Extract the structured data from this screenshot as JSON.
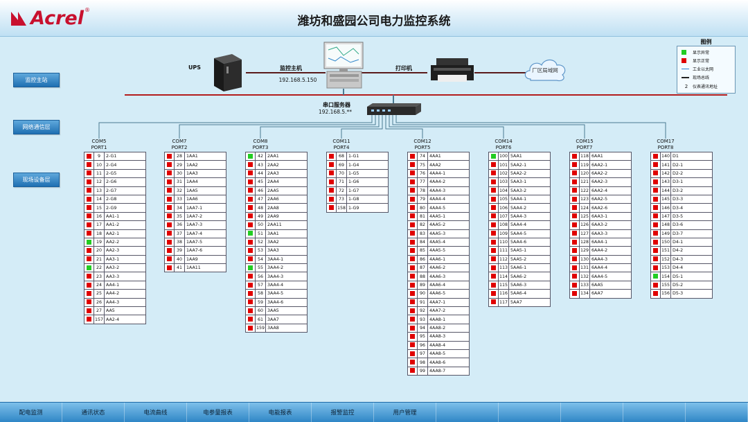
{
  "app": {
    "brand": "Acrel",
    "title": "潍坊和盛园公司电力监控系统"
  },
  "sidebar": [
    {
      "label": "监控主站"
    },
    {
      "label": "网络通信层"
    },
    {
      "label": "现场设备层"
    }
  ],
  "devices": {
    "ups": {
      "label": "UPS"
    },
    "host": {
      "label": "监控主机",
      "ip": "192.168.5.150"
    },
    "printer": {
      "label": "打印机"
    },
    "lan": {
      "label": "厂区局域网"
    },
    "server": {
      "label": "串口服务器",
      "ip": "192.168.5.**"
    }
  },
  "legend": {
    "title": "图例",
    "items": [
      {
        "symbol": "green-square",
        "label": "显示异常"
      },
      {
        "symbol": "red-square",
        "label": "显示正常"
      },
      {
        "symbol": "blue-line",
        "label": "工业以太网"
      },
      {
        "symbol": "black-line",
        "label": "现场总线"
      },
      {
        "symbol": "2",
        "label": "仪表通讯地址"
      }
    ]
  },
  "colors": {
    "normal": "#e00000",
    "abnormal": "#22cc22",
    "accent": "#1f6fb2",
    "bus": "#b31c1c"
  },
  "ports": [
    {
      "com": "COM5",
      "port": "PORT1",
      "rows": [
        {
          "n": "9",
          "name": "2-G1",
          "s": "red"
        },
        {
          "n": "10",
          "name": "2-G4",
          "s": "red"
        },
        {
          "n": "11",
          "name": "2-G5",
          "s": "red"
        },
        {
          "n": "12",
          "name": "2-G6",
          "s": "red"
        },
        {
          "n": "13",
          "name": "2-G7",
          "s": "red"
        },
        {
          "n": "14",
          "name": "2-G8",
          "s": "red"
        },
        {
          "n": "15",
          "name": "2-G9",
          "s": "red"
        },
        {
          "n": "16",
          "name": "AA1-1",
          "s": "red"
        },
        {
          "n": "17",
          "name": "AA1-2",
          "s": "red"
        },
        {
          "n": "18",
          "name": "AA2-1",
          "s": "red"
        },
        {
          "n": "19",
          "name": "AA2-2",
          "s": "green"
        },
        {
          "n": "20",
          "name": "AA2-3",
          "s": "red"
        },
        {
          "n": "21",
          "name": "AA3-1",
          "s": "red"
        },
        {
          "n": "22",
          "name": "AA3-2",
          "s": "green"
        },
        {
          "n": "23",
          "name": "AA3-3",
          "s": "red"
        },
        {
          "n": "24",
          "name": "AA4-1",
          "s": "red"
        },
        {
          "n": "25",
          "name": "AA4-2",
          "s": "red"
        },
        {
          "n": "26",
          "name": "AA4-3",
          "s": "red"
        },
        {
          "n": "27",
          "name": "AA5",
          "s": "red"
        },
        {
          "n": "157",
          "name": "AA2-4",
          "s": "red"
        }
      ]
    },
    {
      "com": "COM7",
      "port": "PORT2",
      "rows": [
        {
          "n": "28",
          "name": "1AA1",
          "s": "red"
        },
        {
          "n": "29",
          "name": "1AA2",
          "s": "red"
        },
        {
          "n": "30",
          "name": "1AA3",
          "s": "red"
        },
        {
          "n": "31",
          "name": "1AA4",
          "s": "red"
        },
        {
          "n": "32",
          "name": "1AA5",
          "s": "red"
        },
        {
          "n": "33",
          "name": "1AA6",
          "s": "red"
        },
        {
          "n": "34",
          "name": "1AA7-1",
          "s": "red"
        },
        {
          "n": "35",
          "name": "1AA7-2",
          "s": "red"
        },
        {
          "n": "36",
          "name": "1AA7-3",
          "s": "red"
        },
        {
          "n": "37",
          "name": "1AA7-4",
          "s": "red"
        },
        {
          "n": "38",
          "name": "1AA7-5",
          "s": "red"
        },
        {
          "n": "39",
          "name": "1AA7-6",
          "s": "red"
        },
        {
          "n": "40",
          "name": "1AA9",
          "s": "red"
        },
        {
          "n": "41",
          "name": "1AA11",
          "s": "red"
        }
      ]
    },
    {
      "com": "COM8",
      "port": "PORT3",
      "rows": [
        {
          "n": "42",
          "name": "2AA1",
          "s": "green"
        },
        {
          "n": "43",
          "name": "2AA2",
          "s": "red"
        },
        {
          "n": "44",
          "name": "2AA3",
          "s": "red"
        },
        {
          "n": "45",
          "name": "2AA4",
          "s": "red"
        },
        {
          "n": "46",
          "name": "2AA5",
          "s": "red"
        },
        {
          "n": "47",
          "name": "2AA6",
          "s": "red"
        },
        {
          "n": "48",
          "name": "2AA8",
          "s": "red"
        },
        {
          "n": "49",
          "name": "2AA9",
          "s": "red"
        },
        {
          "n": "50",
          "name": "2AA11",
          "s": "red"
        },
        {
          "n": "51",
          "name": "3AA1",
          "s": "green"
        },
        {
          "n": "52",
          "name": "3AA2",
          "s": "red"
        },
        {
          "n": "53",
          "name": "3AA3",
          "s": "red"
        },
        {
          "n": "54",
          "name": "3AA4-1",
          "s": "red"
        },
        {
          "n": "55",
          "name": "3AA4-2",
          "s": "green"
        },
        {
          "n": "56",
          "name": "3AA4-3",
          "s": "red"
        },
        {
          "n": "57",
          "name": "3AA4-4",
          "s": "red"
        },
        {
          "n": "58",
          "name": "3AA4-5",
          "s": "red"
        },
        {
          "n": "59",
          "name": "3AA4-6",
          "s": "red"
        },
        {
          "n": "60",
          "name": "3AA5",
          "s": "red"
        },
        {
          "n": "61",
          "name": "3AA7",
          "s": "red"
        },
        {
          "n": "159",
          "name": "3AA8",
          "s": "red"
        }
      ]
    },
    {
      "com": "COM11",
      "port": "PORT4",
      "rows": [
        {
          "n": "68",
          "name": "1-G1",
          "s": "red"
        },
        {
          "n": "69",
          "name": "1-G4",
          "s": "red"
        },
        {
          "n": "70",
          "name": "1-G5",
          "s": "red"
        },
        {
          "n": "71",
          "name": "1-G6",
          "s": "red"
        },
        {
          "n": "72",
          "name": "1-G7",
          "s": "red"
        },
        {
          "n": "73",
          "name": "1-G8",
          "s": "red"
        },
        {
          "n": "158",
          "name": "1-G9",
          "s": "red"
        }
      ]
    },
    {
      "com": "COM12",
      "port": "PORT5",
      "rows": [
        {
          "n": "74",
          "name": "4AA1",
          "s": "red"
        },
        {
          "n": "75",
          "name": "4AA2",
          "s": "red"
        },
        {
          "n": "76",
          "name": "4AA4-1",
          "s": "red"
        },
        {
          "n": "77",
          "name": "4AA4-2",
          "s": "red"
        },
        {
          "n": "78",
          "name": "4AA4-3",
          "s": "red"
        },
        {
          "n": "79",
          "name": "4AA4-4",
          "s": "red"
        },
        {
          "n": "80",
          "name": "4AA4-5",
          "s": "red"
        },
        {
          "n": "81",
          "name": "4AA5-1",
          "s": "red"
        },
        {
          "n": "82",
          "name": "4AA5-2",
          "s": "red"
        },
        {
          "n": "83",
          "name": "4AA5-3",
          "s": "red"
        },
        {
          "n": "84",
          "name": "4AA5-4",
          "s": "red"
        },
        {
          "n": "85",
          "name": "4AA5-5",
          "s": "red"
        },
        {
          "n": "86",
          "name": "4AA6-1",
          "s": "red"
        },
        {
          "n": "87",
          "name": "4AA6-2",
          "s": "red"
        },
        {
          "n": "88",
          "name": "4AA6-3",
          "s": "red"
        },
        {
          "n": "89",
          "name": "4AA6-4",
          "s": "red"
        },
        {
          "n": "90",
          "name": "4AA6-5",
          "s": "red"
        },
        {
          "n": "91",
          "name": "4AA7-1",
          "s": "red"
        },
        {
          "n": "92",
          "name": "4AA7-2",
          "s": "red"
        },
        {
          "n": "93",
          "name": "4AA8-1",
          "s": "red"
        },
        {
          "n": "94",
          "name": "4AA8-2",
          "s": "red"
        },
        {
          "n": "95",
          "name": "4AA8-3",
          "s": "red"
        },
        {
          "n": "96",
          "name": "4AA8-4",
          "s": "red"
        },
        {
          "n": "97",
          "name": "4AA8-5",
          "s": "red"
        },
        {
          "n": "98",
          "name": "4AA8-6",
          "s": "red"
        },
        {
          "n": "99",
          "name": "4AA8-7",
          "s": "red"
        }
      ]
    },
    {
      "com": "COM14",
      "port": "PORT6",
      "rows": [
        {
          "n": "100",
          "name": "5AA1",
          "s": "green"
        },
        {
          "n": "101",
          "name": "5AA2-1",
          "s": "red"
        },
        {
          "n": "102",
          "name": "5AA2-2",
          "s": "red"
        },
        {
          "n": "103",
          "name": "5AA3-1",
          "s": "red"
        },
        {
          "n": "104",
          "name": "5AA3-2",
          "s": "red"
        },
        {
          "n": "105",
          "name": "5AA4-1",
          "s": "red"
        },
        {
          "n": "106",
          "name": "5AA4-2",
          "s": "red"
        },
        {
          "n": "107",
          "name": "5AA4-3",
          "s": "red"
        },
        {
          "n": "108",
          "name": "5AA4-4",
          "s": "red"
        },
        {
          "n": "109",
          "name": "5AA4-5",
          "s": "red"
        },
        {
          "n": "110",
          "name": "5AA4-6",
          "s": "red"
        },
        {
          "n": "111",
          "name": "5AA5-1",
          "s": "red"
        },
        {
          "n": "112",
          "name": "5AA5-2",
          "s": "red"
        },
        {
          "n": "113",
          "name": "5AA6-1",
          "s": "red"
        },
        {
          "n": "114",
          "name": "5AA6-2",
          "s": "red"
        },
        {
          "n": "115",
          "name": "5AA6-3",
          "s": "red"
        },
        {
          "n": "116",
          "name": "5AA6-4",
          "s": "red"
        },
        {
          "n": "117",
          "name": "5AA7",
          "s": "red"
        }
      ]
    },
    {
      "com": "COM15",
      "port": "PORT7",
      "rows": [
        {
          "n": "118",
          "name": "6AA1",
          "s": "red"
        },
        {
          "n": "119",
          "name": "6AA2-1",
          "s": "red"
        },
        {
          "n": "120",
          "name": "6AA2-2",
          "s": "red"
        },
        {
          "n": "121",
          "name": "6AA2-3",
          "s": "red"
        },
        {
          "n": "122",
          "name": "6AA2-4",
          "s": "red"
        },
        {
          "n": "123",
          "name": "6AA2-5",
          "s": "red"
        },
        {
          "n": "124",
          "name": "6AA2-6",
          "s": "red"
        },
        {
          "n": "125",
          "name": "6AA3-1",
          "s": "red"
        },
        {
          "n": "126",
          "name": "6AA3-2",
          "s": "red"
        },
        {
          "n": "127",
          "name": "6AA3-3",
          "s": "red"
        },
        {
          "n": "128",
          "name": "6AA4-1",
          "s": "red"
        },
        {
          "n": "129",
          "name": "6AA4-2",
          "s": "red"
        },
        {
          "n": "130",
          "name": "6AA4-3",
          "s": "red"
        },
        {
          "n": "131",
          "name": "6AA4-4",
          "s": "red"
        },
        {
          "n": "132",
          "name": "6AA4-5",
          "s": "red"
        },
        {
          "n": "133",
          "name": "6AA5",
          "s": "red"
        },
        {
          "n": "134",
          "name": "6AA7",
          "s": "red"
        }
      ]
    },
    {
      "com": "COM17",
      "port": "PORT8",
      "rows": [
        {
          "n": "140",
          "name": "D1",
          "s": "red"
        },
        {
          "n": "141",
          "name": "D2-1",
          "s": "red"
        },
        {
          "n": "142",
          "name": "D2-2",
          "s": "red"
        },
        {
          "n": "143",
          "name": "D3-1",
          "s": "red"
        },
        {
          "n": "144",
          "name": "D3-2",
          "s": "red"
        },
        {
          "n": "145",
          "name": "D3-3",
          "s": "red"
        },
        {
          "n": "146",
          "name": "D3-4",
          "s": "red"
        },
        {
          "n": "147",
          "name": "D3-5",
          "s": "red"
        },
        {
          "n": "148",
          "name": "D3-6",
          "s": "red"
        },
        {
          "n": "149",
          "name": "D3-7",
          "s": "red"
        },
        {
          "n": "150",
          "name": "D4-1",
          "s": "red"
        },
        {
          "n": "151",
          "name": "D4-2",
          "s": "red"
        },
        {
          "n": "152",
          "name": "D4-3",
          "s": "red"
        },
        {
          "n": "153",
          "name": "D4-4",
          "s": "red"
        },
        {
          "n": "154",
          "name": "D5-1",
          "s": "green"
        },
        {
          "n": "155",
          "name": "D5-2",
          "s": "red"
        },
        {
          "n": "156",
          "name": "D5-3",
          "s": "red"
        }
      ]
    }
  ],
  "nav": [
    {
      "label": "配电监测"
    },
    {
      "label": "通讯状态"
    },
    {
      "label": "电流曲线"
    },
    {
      "label": "电参量报表"
    },
    {
      "label": "电能报表"
    },
    {
      "label": "报警监控"
    },
    {
      "label": "用户管理"
    },
    {
      "label": ""
    },
    {
      "label": ""
    },
    {
      "label": ""
    },
    {
      "label": ""
    },
    {
      "label": ""
    }
  ]
}
